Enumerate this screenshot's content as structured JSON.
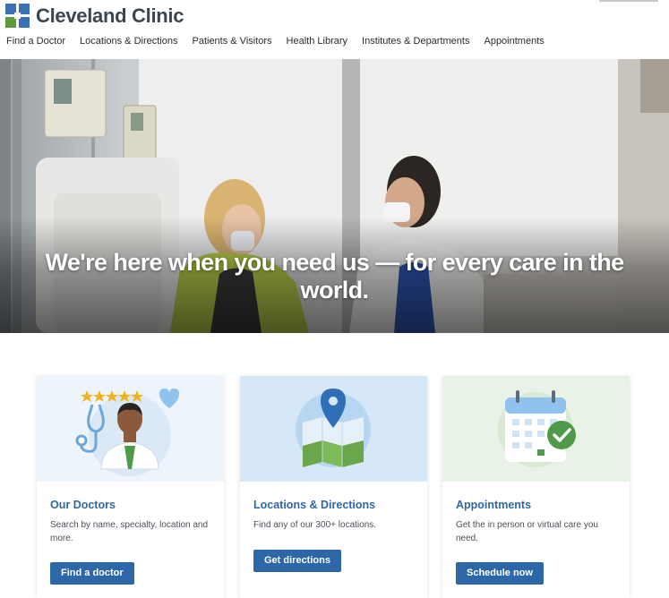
{
  "brand": {
    "name": "Cleveland Clinic",
    "colors": {
      "blue": "#3b6fb6",
      "green": "#5e9a3d",
      "text": "#3c4650"
    }
  },
  "nav": {
    "items": [
      {
        "label": "Find a Doctor"
      },
      {
        "label": "Locations & Directions"
      },
      {
        "label": "Patients & Visitors"
      },
      {
        "label": "Health Library"
      },
      {
        "label": "Institutes & Departments"
      },
      {
        "label": "Appointments"
      }
    ]
  },
  "hero": {
    "heading": "We're here when you need us — for every care in the world."
  },
  "cards": [
    {
      "title": "Our Doctors",
      "description": "Search by name, specialty, location and more.",
      "button": "Find a doctor",
      "icon": "doctor-illustration"
    },
    {
      "title": "Locations & Directions",
      "description": "Find any of our 300+ locations.",
      "button": "Get directions",
      "icon": "map-pin-illustration"
    },
    {
      "title": "Appointments",
      "description": "Get the in person or virtual care you need.",
      "button": "Schedule now",
      "icon": "calendar-check-illustration"
    }
  ]
}
